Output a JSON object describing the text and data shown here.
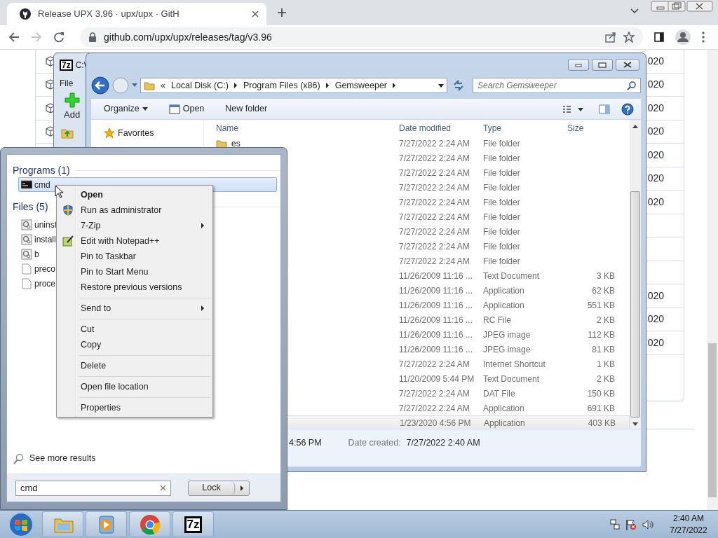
{
  "browser": {
    "tab": {
      "title": "Release UPX 3.96 · upx/upx · GitH",
      "selected": true
    },
    "address": "github.com/upx/upx/releases/tag/v3.96"
  },
  "page": {
    "rows": [
      {
        "kind": "year",
        "text": "020"
      },
      {
        "kind": "year",
        "text": "020"
      },
      {
        "kind": "year",
        "text": "020"
      },
      {
        "kind": "year",
        "text": "020"
      },
      {
        "kind": "year",
        "text": "020"
      },
      {
        "kind": "year",
        "text": "020"
      },
      {
        "kind": "year",
        "text": "020"
      },
      {
        "kind": "blank"
      },
      {
        "kind": "blank"
      },
      {
        "kind": "blank"
      },
      {
        "kind": "year",
        "text": "020"
      },
      {
        "kind": "year",
        "text": "020"
      },
      {
        "kind": "year",
        "text": "020"
      }
    ]
  },
  "zip_window": {
    "icon_text": "7z",
    "title": "C:\\",
    "menu": [
      "File"
    ],
    "toolbar": [
      "Add"
    ]
  },
  "explorer": {
    "breadcrumb_prefix": "«",
    "breadcrumbs": [
      "Local Disk (C:)",
      "Program Files (x86)",
      "Gemsweeper"
    ],
    "search": {
      "placeholder": "Search Gemsweeper"
    },
    "toolbar": [
      {
        "label": "Organize",
        "kind": "menu"
      },
      {
        "label": "Open",
        "kind": "icon"
      },
      {
        "label": "New folder",
        "kind": "plain"
      }
    ],
    "nav": [
      {
        "label": "Favorites"
      }
    ],
    "columns": [
      "Name",
      "Date modified",
      "Type",
      "Size"
    ],
    "rows": [
      {
        "name": "es",
        "date": "7/27/2022 2:24 AM",
        "type": "File folder",
        "selected": false
      },
      {
        "date": "7/27/2022 2:24 AM",
        "type": "File folder",
        "selected": false
      },
      {
        "date": "7/27/2022 2:24 AM",
        "type": "File folder",
        "selected": false
      },
      {
        "date": "7/27/2022 2:24 AM",
        "type": "File folder",
        "selected": false
      },
      {
        "date": "7/27/2022 2:24 AM",
        "type": "File folder",
        "selected": false
      },
      {
        "date": "7/27/2022 2:24 AM",
        "type": "File folder",
        "selected": false
      },
      {
        "date": "7/27/2022 2:24 AM",
        "type": "File folder",
        "selected": false
      },
      {
        "date": "7/27/2022 2:24 AM",
        "type": "File folder",
        "selected": false
      },
      {
        "date": "7/27/2022 2:24 AM",
        "type": "File folder",
        "selected": false
      },
      {
        "date": "11/26/2009 11:16 ...",
        "type": "Text Document",
        "size": "3 KB",
        "selected": false
      },
      {
        "date": "11/26/2009 11:16 ...",
        "type": "Application",
        "size": "62 KB",
        "selected": false
      },
      {
        "date": "11/26/2009 11:16 ...",
        "type": "Application",
        "size": "551 KB",
        "selected": false
      },
      {
        "date": "11/26/2009 11:16 ...",
        "type": "RC File",
        "size": "2 KB",
        "selected": false
      },
      {
        "date": "11/26/2009 11:16 ...",
        "type": "JPEG image",
        "size": "112 KB",
        "selected": false
      },
      {
        "date": "11/26/2009 11:16 ...",
        "type": "JPEG image",
        "size": "81 KB",
        "selected": false
      },
      {
        "date": "7/27/2022 2:24 AM",
        "type": "Internet Shortcut",
        "size": "1 KB",
        "selected": false
      },
      {
        "date": "11/20/2009 5:44 PM",
        "type": "Text Document",
        "size": "2 KB",
        "selected": false
      },
      {
        "date": "7/27/2022 2:24 AM",
        "type": "DAT File",
        "size": "150 KB",
        "selected": false
      },
      {
        "date": "7/27/2022 2:24 AM",
        "type": "Application",
        "size": "691 KB",
        "selected": false
      },
      {
        "date": "1/23/2020 4:56 PM",
        "type": "Application",
        "size": "403 KB",
        "selected": true
      }
    ],
    "details": {
      "modified": "4:56 PM",
      "created_label": "Date created:",
      "created": "7/27/2022 2:40 AM"
    }
  },
  "start_menu": {
    "groups": [
      {
        "title": "Programs (1)",
        "items": [
          {
            "label": "cmd",
            "kind": "console",
            "selected": true
          }
        ]
      },
      {
        "title": "Files (5)",
        "items": [
          {
            "label": "uninst",
            "kind": "gear",
            "selected": false
          },
          {
            "label": "install",
            "kind": "gear",
            "selected": false
          },
          {
            "label": "b",
            "kind": "gear",
            "selected": false
          },
          {
            "label": "preco",
            "kind": "file",
            "selected": false
          },
          {
            "label": "proce",
            "kind": "file",
            "selected": false
          }
        ]
      }
    ],
    "see_more": "See more results",
    "search": {
      "value": "cmd"
    },
    "power_button": "Lock"
  },
  "context_menu": {
    "groups": [
      [
        {
          "label": "Open",
          "kind": "text",
          "default": true,
          "submenu": false
        },
        {
          "label": "Run as administrator",
          "kind": "shield",
          "default": false,
          "submenu": false
        },
        {
          "label": "7-Zip",
          "kind": "text",
          "default": false,
          "submenu": true
        },
        {
          "label": "Edit with Notepad++",
          "kind": "notepad",
          "default": false,
          "submenu": false
        },
        {
          "label": "Pin to Taskbar",
          "default": false,
          "submenu": false
        },
        {
          "label": "Pin to Start Menu",
          "default": false,
          "submenu": false
        },
        {
          "label": "Restore previous versions",
          "default": false,
          "submenu": false
        }
      ],
      [
        {
          "label": "Send to",
          "default": false,
          "submenu": true
        }
      ],
      [
        {
          "label": "Cut",
          "default": false,
          "submenu": false
        },
        {
          "label": "Copy",
          "default": false,
          "submenu": false
        }
      ],
      [
        {
          "label": "Delete",
          "default": false,
          "submenu": false
        }
      ],
      [
        {
          "label": "Open file location",
          "default": false,
          "submenu": false
        }
      ],
      [
        {
          "label": "Properties",
          "default": false,
          "submenu": false
        }
      ]
    ]
  },
  "taskbar": {
    "apps": [
      {
        "kind": "folder"
      },
      {
        "kind": "media"
      },
      {
        "kind": "chrome"
      },
      {
        "kind": "zip",
        "label": "7z"
      }
    ],
    "time": "2:40 AM",
    "date": "7/27/2022"
  }
}
